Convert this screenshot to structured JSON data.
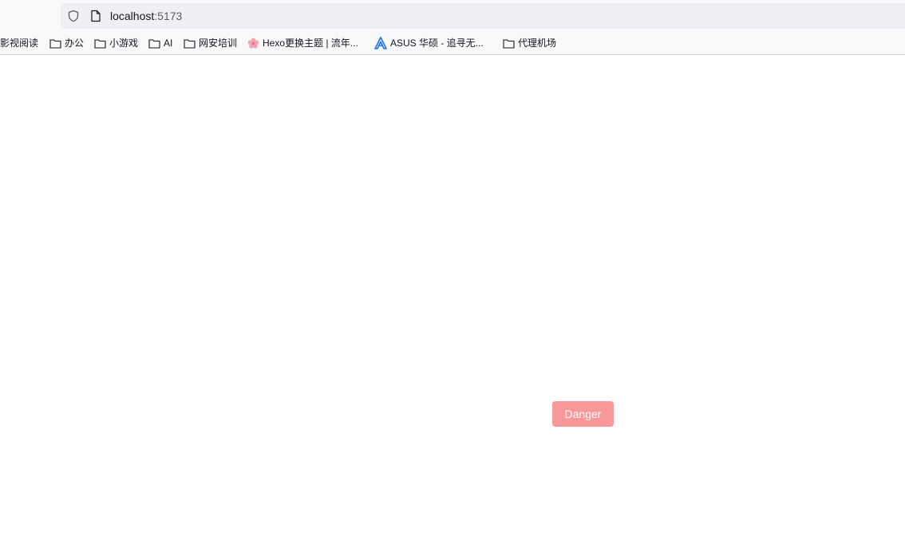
{
  "browser": {
    "url": {
      "host": "localhost",
      "port": ":5173"
    },
    "bookmarks": [
      {
        "label": "影视阅读",
        "icon": "none"
      },
      {
        "label": "办公",
        "icon": "folder-icon"
      },
      {
        "label": "小游戏",
        "icon": "folder-icon"
      },
      {
        "label": "AI",
        "icon": "folder-icon"
      },
      {
        "label": "网安培训",
        "icon": "folder-icon"
      },
      {
        "label": "Hexo更换主题 | 流年...",
        "icon": "sakura-flower-icon"
      },
      {
        "label": "ASUS 华硕 - 追寻无...",
        "icon": "asus-logo-icon"
      },
      {
        "label": "代理机场",
        "icon": "folder-icon"
      }
    ]
  },
  "page": {
    "danger_button_label": "Danger",
    "danger_button_color": "#f89898"
  }
}
